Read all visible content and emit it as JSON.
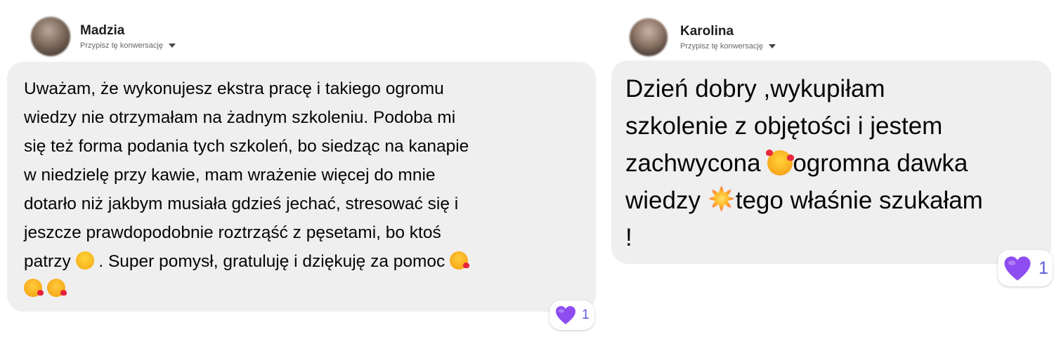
{
  "colors": {
    "bubble_bg": "#efefef",
    "reaction_heart": "#8e4df0",
    "reaction_count": "#5b5bd6",
    "secondary_text": "#65676b"
  },
  "conversations": [
    {
      "author": "Madzia",
      "assign_label": "Przypisz tę konwersację",
      "message_lines": [
        "Uważam, że wykonujesz ekstra pracę i takiego ogromu",
        "wiedzy nie otrzymałam na żadnym szkoleniu. Podoba mi",
        "się też forma podania tych szkoleń, bo siedząc na kanapie",
        "w niedzielę przy kawie, mam wrażenie więcej do mnie",
        "dotarło niż jakbym musiała gdzieś jechać, stresować się i",
        "jeszcze prawdopodobnie roztrząść z pęsetami, bo ktoś"
      ],
      "message_tail_a": "patrzy",
      "message_tail_b": " . Super pomysł, gratuluję i dziękuję za pomoc ",
      "emojis": [
        "grinning-sweat-emoji",
        "face-blowing-kiss-emoji"
      ],
      "reaction": {
        "icon": "purple-heart-icon",
        "count": "1"
      }
    },
    {
      "author": "Karolina",
      "assign_label": "Przypisz tę konwersację",
      "message_lines": [
        "Dzień dobry ,wykupiłam",
        "szkolenie z objętości i jestem"
      ],
      "message_line3": "zachwycona ",
      "message_line3_tail": "ogromna dawka",
      "message_line4": "wiedzy ",
      "message_line4_tail": "tego właśnie szukałam",
      "message_line5": "!",
      "emojis": [
        "smiling-face-with-hearts-emoji",
        "collision-emoji"
      ],
      "reaction": {
        "icon": "purple-heart-icon",
        "count": "1"
      }
    }
  ]
}
